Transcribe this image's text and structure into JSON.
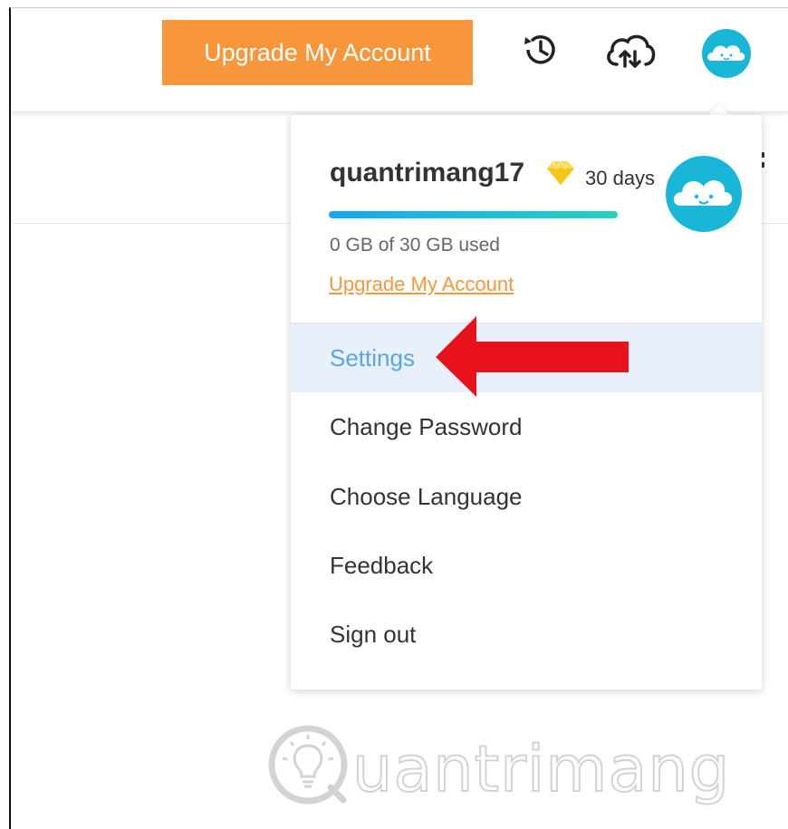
{
  "header": {
    "upgrade_button": "Upgrade My Account",
    "icons": [
      "history-icon",
      "cloud-upload-icon",
      "avatar-icon"
    ]
  },
  "account": {
    "username": "quantrimang17",
    "premium_days": "30 days",
    "storage_used_fraction": 0,
    "storage_text": "0 GB of 30 GB used",
    "upgrade_link": "Upgrade My Account"
  },
  "menu": {
    "items": [
      {
        "label": "Settings",
        "active": true
      },
      {
        "label": "Change Password",
        "active": false
      },
      {
        "label": "Choose Language",
        "active": false
      },
      {
        "label": "Feedback",
        "active": false
      },
      {
        "label": "Sign out",
        "active": false
      }
    ]
  },
  "watermark": {
    "text": "uantrimang"
  },
  "colors": {
    "accent_orange": "#f7963b",
    "active_blue": "#5aa5ea",
    "avatar_teal": "#19b6d8",
    "arrow_red": "#e8121a"
  }
}
